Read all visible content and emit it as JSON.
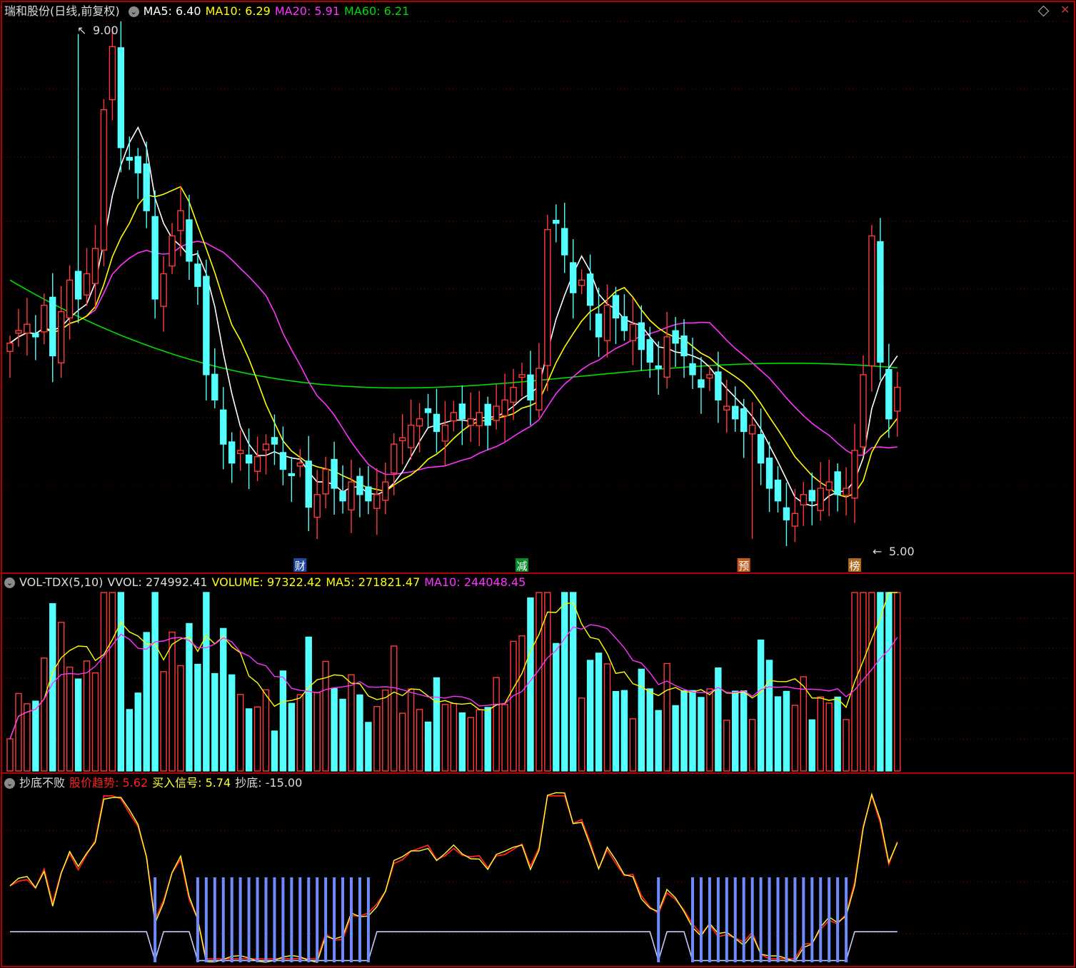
{
  "colors": {
    "up": "#ff3b3b",
    "down": "#54ffff",
    "ma5": "#ffffff",
    "ma10": "#ffff00",
    "ma20": "#ff33ff",
    "ma60": "#00dd00",
    "grid": "#8b0000",
    "border": "#b00000",
    "trend": "#ff2020",
    "buy": "#ffff30",
    "bottom_line": "#c8c8ff"
  },
  "main": {
    "title": "瑞和股份(日线,前复权)",
    "ma5_label": "MA5: 6.40",
    "ma10_label": "MA10: 6.29",
    "ma20_label": "MA20: 5.91",
    "ma60_label": "MA60: 6.21",
    "high_mark": "9.00",
    "low_mark": "5.00",
    "events": [
      {
        "text": "财",
        "bg": "#1f4aa8",
        "index": 34
      },
      {
        "text": "减",
        "bg": "#0a8a2a",
        "index": 60
      },
      {
        "text": "预",
        "bg": "#c85a1a",
        "index": 86
      },
      {
        "text": "榜",
        "bg": "#b06a20",
        "index": 99
      }
    ]
  },
  "volume": {
    "header": "VOL-TDX(5,10)",
    "vvol": "VVOL: 274992.41",
    "volume": "VOLUME: 97322.42",
    "ma5": "MA5: 271821.47",
    "ma10": "MA10: 244048.45"
  },
  "indicator": {
    "header": "抄底不败",
    "trend": "股价趋势: 5.62",
    "buy": "买入信号: 5.74",
    "bottom": "抄底: -15.00"
  },
  "chart_data": [
    {
      "type": "candlestick",
      "title": "瑞和股份(日线,前复权)",
      "ylim": [
        4.8,
        9.1
      ],
      "grid": true,
      "marked_high": 9.0,
      "marked_low": 5.0,
      "close": [
        6.55,
        6.65,
        6.7,
        6.6,
        6.85,
        6.45,
        6.8,
        7.05,
        6.9,
        7.1,
        7.3,
        8.4,
        8.9,
        8.1,
        8.0,
        7.9,
        7.6,
        6.9,
        7.1,
        7.4,
        7.6,
        7.2,
        7.0,
        6.3,
        6.1,
        5.75,
        5.6,
        5.7,
        5.6,
        5.65,
        5.75,
        5.75,
        5.55,
        5.5,
        5.6,
        5.25,
        5.35,
        5.55,
        5.4,
        5.3,
        5.45,
        5.35,
        5.3,
        5.35,
        5.45,
        5.75,
        5.8,
        5.9,
        5.95,
        6.0,
        5.85,
        5.9,
        6.0,
        5.95,
        5.95,
        6.0,
        5.9,
        6.05,
        6.1,
        6.2,
        6.3,
        6.1,
        6.35,
        7.45,
        7.5,
        7.25,
        6.95,
        7.05,
        6.85,
        6.6,
        6.85,
        6.75,
        6.65,
        6.7,
        6.5,
        6.4,
        6.35,
        6.6,
        6.55,
        6.45,
        6.3,
        6.2,
        6.3,
        6.1,
        6.05,
        5.95,
        5.85,
        5.9,
        5.6,
        5.4,
        5.3,
        5.15,
        5.2,
        5.35,
        5.3,
        5.4,
        5.45,
        5.35,
        5.4,
        5.7,
        6.3,
        7.4,
        6.4,
        5.95,
        6.2
      ],
      "ma60_last": 6.21,
      "ma20_last": 5.91,
      "ma10_last": 6.29,
      "ma5_last": 6.4
    },
    {
      "type": "bar",
      "title": "VOL-TDX(5,10)",
      "vvol": 274992.41,
      "volume_last": 97322.42,
      "ma5_last": 271821.47,
      "ma10_last": 244048.45
    },
    {
      "type": "line",
      "title": "抄底不败",
      "series": [
        {
          "name": "股价趋势",
          "last": 5.62
        },
        {
          "name": "买入信号",
          "last": 5.74
        },
        {
          "name": "抄底",
          "last": -15.0
        }
      ]
    }
  ]
}
